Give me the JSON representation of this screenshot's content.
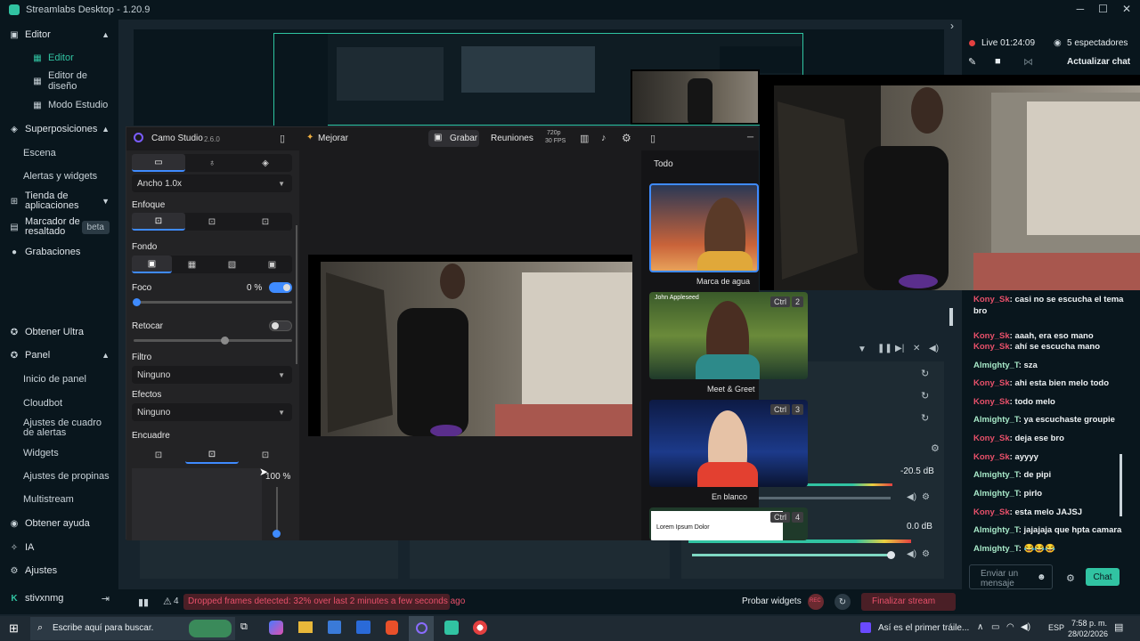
{
  "app": {
    "title": "Streamlabs Desktop - 1.20.9"
  },
  "sidebar": {
    "items": [
      {
        "label": "Editor",
        "type": "group"
      },
      {
        "label": "Editor",
        "type": "sub",
        "active": true
      },
      {
        "label": "Editor de diseño",
        "type": "sub"
      },
      {
        "label": "Modo Estudio",
        "type": "sub"
      },
      {
        "label": "Superposiciones",
        "type": "group"
      },
      {
        "label": "Escena",
        "type": "sub"
      },
      {
        "label": "Alertas y widgets",
        "type": "sub"
      },
      {
        "label": "Tienda de aplicaciones",
        "type": "group"
      },
      {
        "label": "Marcador de resaltado",
        "type": "group",
        "badge": "beta"
      },
      {
        "label": "Grabaciones",
        "type": "group"
      },
      {
        "label": "Obtener Ultra",
        "type": "group"
      },
      {
        "label": "Panel",
        "type": "group"
      },
      {
        "label": "Inicio de panel",
        "type": "sub"
      },
      {
        "label": "Cloudbot",
        "type": "sub"
      },
      {
        "label": "Ajustes de cuadro de alertas",
        "type": "sub"
      },
      {
        "label": "Widgets",
        "type": "sub"
      },
      {
        "label": "Ajustes de propinas",
        "type": "sub"
      },
      {
        "label": "Multistream",
        "type": "sub"
      },
      {
        "label": "Obtener ayuda",
        "type": "group"
      },
      {
        "label": "IA",
        "type": "group"
      },
      {
        "label": "Ajustes",
        "type": "group"
      }
    ],
    "user": "stivxnmg"
  },
  "camo": {
    "title": "Camo Studio",
    "version": "2.6.0",
    "mejorar": "Mejorar",
    "grabar": "Grabar",
    "reuniones": "Reuniones",
    "res": "720p",
    "fps": "30 FPS",
    "zoom_dropdown": "Ancho 1.0x",
    "enfoque": "Enfoque",
    "fondo": "Fondo",
    "foco": "Foco",
    "foco_value": "0 %",
    "retocar": "Retocar",
    "filtro": "Filtro",
    "filtro_value": "Ninguno",
    "efectos": "Efectos",
    "efectos_value": "Ninguno",
    "encuadre": "Encuadre",
    "zoom_pct": "100 %",
    "right_filter": "Todo",
    "thumbs": [
      {
        "label": "Marca de agua"
      },
      {
        "label": "Meet & Greet",
        "ctrl": "Ctrl",
        "key": "2",
        "header": "John Appleseed"
      },
      {
        "label": "En blanco",
        "ctrl": "Ctrl",
        "key": "3"
      },
      {
        "label": "",
        "ctrl": "Ctrl",
        "key": "4",
        "text": "Lorem Ipsum Dolor"
      }
    ]
  },
  "stream": {
    "live": "Live 01:24:09",
    "viewers": "5 espectadores",
    "update_chat": "Actualizar chat"
  },
  "mixer": {
    "db1": "-20.5 dB",
    "db2": "0.0 dB"
  },
  "chat": {
    "messages": [
      {
        "user": "Kony_Sk",
        "color": "red",
        "text": "casi no se escucha el tema bro"
      },
      {
        "user": "Kony_Sk",
        "color": "red",
        "text": "aaah, era eso mano"
      },
      {
        "user": "Kony_Sk",
        "color": "red",
        "text": "ahí se escucha mano"
      },
      {
        "user": "Almighty_T",
        "color": "green",
        "text": "sza"
      },
      {
        "user": "Kony_Sk",
        "color": "red",
        "text": "ahi esta bien melo todo"
      },
      {
        "user": "Kony_Sk",
        "color": "red",
        "text": "todo melo"
      },
      {
        "user": "Almighty_T",
        "color": "green",
        "text": "ya escuchaste groupie"
      },
      {
        "user": "Kony_Sk",
        "color": "red",
        "text": "deja ese bro"
      },
      {
        "user": "Kony_Sk",
        "color": "red",
        "text": "ayyyy"
      },
      {
        "user": "Almighty_T",
        "color": "green",
        "text": "de pipi"
      },
      {
        "user": "Almighty_T",
        "color": "green",
        "text": "pirlo"
      },
      {
        "user": "Kony_Sk",
        "color": "red",
        "text": "esta melo JAJSJ"
      },
      {
        "user": "Almighty_T",
        "color": "green",
        "text": "jajajaja que hpta camara"
      },
      {
        "user": "Almighty_T",
        "color": "green",
        "text": "😂😂😂"
      }
    ],
    "input_placeholder": "Enviar un mensaje",
    "send": "Chat"
  },
  "status": {
    "alerts_count": "4",
    "dropped": "Dropped frames detected: 32% over last 2 minutes a few seconds ago",
    "test_widgets": "Probar widgets",
    "end_stream": "Finalizar stream",
    "rec": "REC"
  },
  "taskbar": {
    "search": "Escribe aquí para buscar.",
    "media": "Así es el primer tráile...",
    "lang": "ESP",
    "time": "7:58 p. m.",
    "date": "28/02/2026"
  }
}
